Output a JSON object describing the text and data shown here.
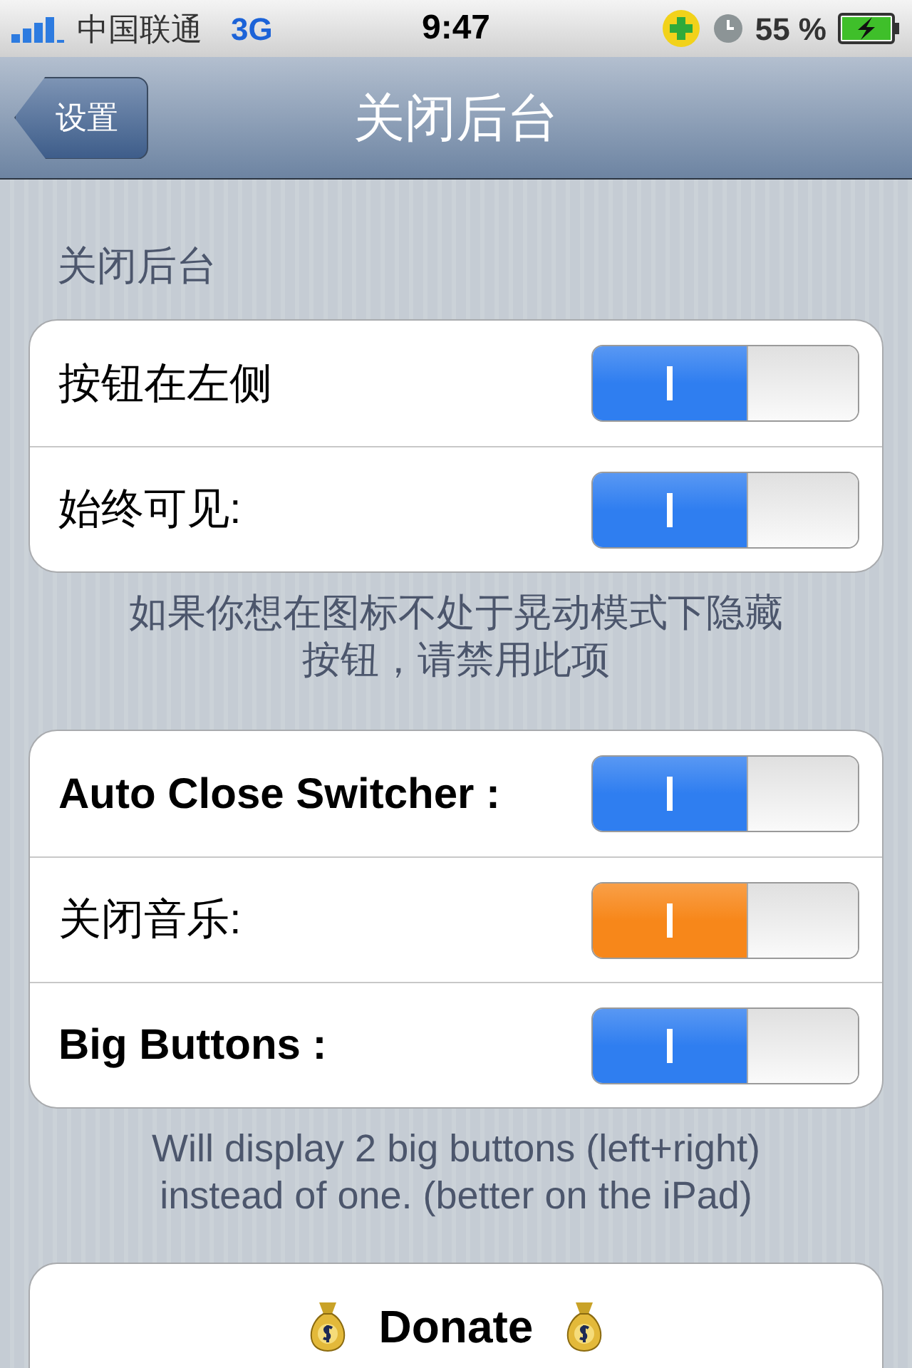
{
  "status_bar": {
    "carrier": "中国联通",
    "network": "3G",
    "time": "9:47",
    "battery": "55 %"
  },
  "nav_bar": {
    "back": "设置",
    "title": "关闭后台"
  },
  "section_header": "关闭后台",
  "groups": [
    {
      "rows": [
        {
          "label": "按钮在左侧",
          "bold": false,
          "on": true,
          "color": "#2f7ef0"
        },
        {
          "label": "始终可见:",
          "bold": false,
          "on": true,
          "color": "#2f7ef0"
        }
      ],
      "footer": [
        "如果你想在图标不处于晃动模式下隐藏",
        "按钮，请禁用此项"
      ]
    },
    {
      "rows": [
        {
          "label": "Auto Close Switcher :",
          "bold": true,
          "on": true,
          "color": "#2f7ef0"
        },
        {
          "label": "关闭音乐:",
          "bold": false,
          "on": true,
          "color": "#f7871a"
        },
        {
          "label": "Big Buttons :",
          "bold": true,
          "on": true,
          "color": "#2f7ef0"
        }
      ],
      "footer": [
        "Will display 2 big buttons (left+right)",
        "instead of one. (better on the iPad)"
      ]
    }
  ],
  "donate_button": "Donate"
}
